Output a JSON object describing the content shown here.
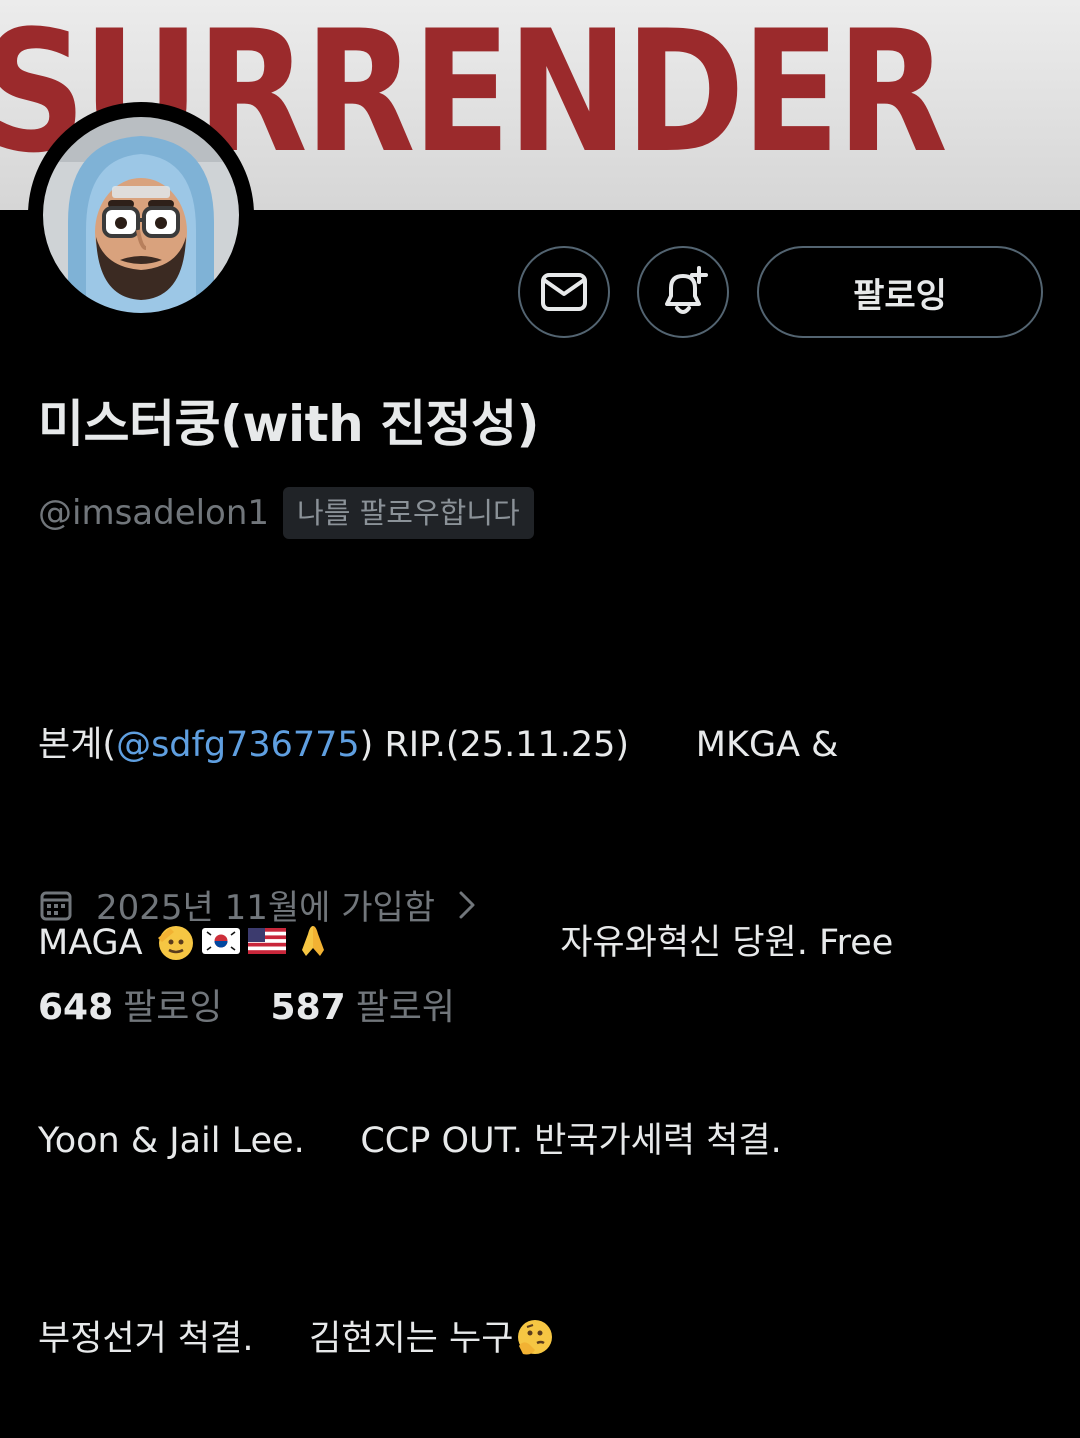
{
  "banner": {
    "text": "SURRENDER"
  },
  "actions": {
    "follow_label": "팔로잉"
  },
  "profile": {
    "display_name": "미스터쿵(with 진정성)",
    "handle": "@imsadelon1",
    "follows_you": "나를 팔로우합니다",
    "bio": {
      "line1_prefix": "본계(",
      "line1_mention": "@sdfg736775",
      "line1_suffix": ") RIP.(25.11.25)      MKGA &",
      "line2_prefix": "MAGA ",
      "line2_suffix": "                    자유와혁신 당원. Free",
      "line3": "Yoon & Jail Lee.     CCP OUT. 반국가세력 척결.",
      "line4": "부정선거 척결.     김현지는 누구"
    },
    "joined": "2025년 11월에 가입함"
  },
  "stats": {
    "following_count": "648",
    "following_label": "팔로잉",
    "followers_count": "587",
    "followers_label": "팔로워"
  },
  "icons": {
    "message": "envelope-icon",
    "notify": "bell-plus-icon",
    "calendar": "calendar-icon",
    "chevron": "chevron-right-icon",
    "emojis": [
      "saluting-face",
      "flag-south-korea",
      "flag-united-states",
      "folded-hands",
      "thinking-face"
    ]
  },
  "colors": {
    "background": "#000000",
    "banner_text": "#9b2a2c",
    "mention": "#5f9fe0",
    "muted_text": "#71767b",
    "button_border": "#536471"
  }
}
